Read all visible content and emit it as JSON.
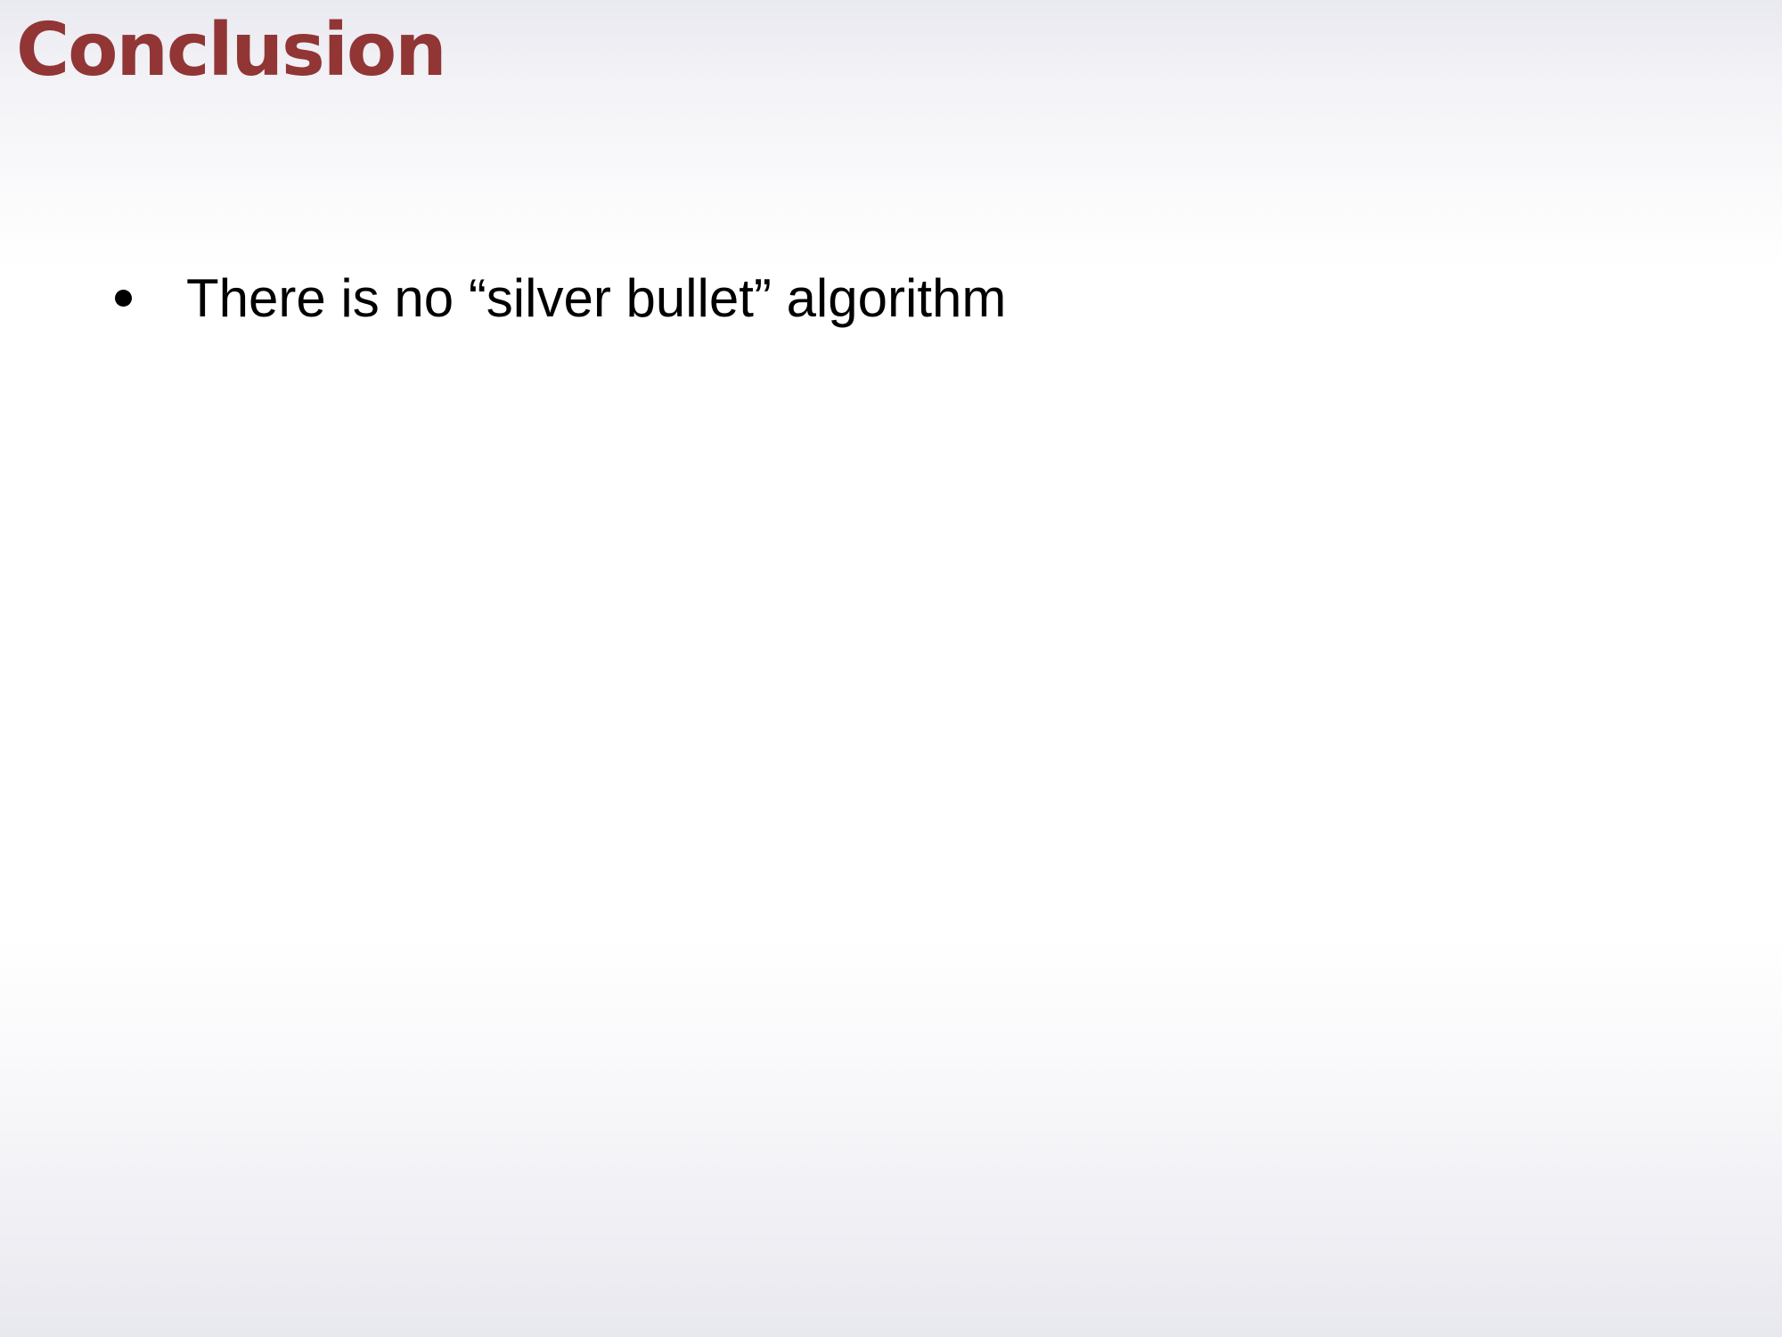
{
  "slide": {
    "title": "Conclusion",
    "title_color": "#913635",
    "bullets": [
      {
        "text": "There is no “silver bullet” algorithm"
      }
    ]
  }
}
